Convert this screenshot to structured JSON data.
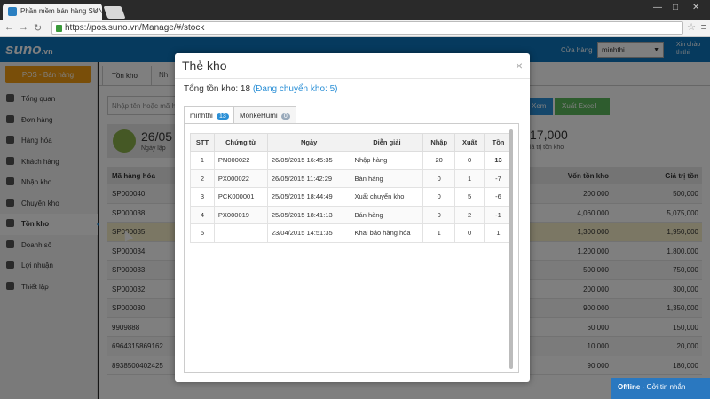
{
  "browser": {
    "tab_title": "Phần mềm bán hàng SUNO",
    "url": "https://pos.suno.vn/Manage/#/stock"
  },
  "header": {
    "logo_main": "suno",
    "logo_suffix": ".vn",
    "store_label": "Cửa hàng",
    "store_value": "minhthi",
    "greeting_line1": "Xin chào",
    "greeting_line2": "thithi"
  },
  "sidebar": {
    "pos_button": "POS - Bán hàng",
    "items": [
      {
        "label": "Tổng quan"
      },
      {
        "label": "Đơn hàng"
      },
      {
        "label": "Hàng hóa"
      },
      {
        "label": "Khách hàng"
      },
      {
        "label": "Nhập kho"
      },
      {
        "label": "Chuyển kho"
      },
      {
        "label": "Tồn kho"
      },
      {
        "label": "Doanh số"
      },
      {
        "label": "Lợi nhuận"
      },
      {
        "label": "Thiết lập"
      }
    ]
  },
  "main": {
    "tab_active": "Tồn kho",
    "tab_second": "Nh",
    "search_placeholder": "Nhập tên hoặc mã h",
    "btn_view": "Xem",
    "btn_excel": "Xuất Excel",
    "summary_left_value": "26/05",
    "summary_left_label": "Ngày lập",
    "summary_right_value": "17,000",
    "summary_right_label": "iá trị tồn kho",
    "grid_headers": [
      "Mã hàng hóa",
      "Vốn tồn kho",
      "Giá trị tồn"
    ],
    "grid_rows": [
      [
        "SP000040",
        "200,000",
        "500,000"
      ],
      [
        "SP000038",
        "4,060,000",
        "5,075,000"
      ],
      [
        "SP000035",
        "1,300,000",
        "1,950,000"
      ],
      [
        "SP000034",
        "1,200,000",
        "1,800,000"
      ],
      [
        "SP000033",
        "500,000",
        "750,000"
      ],
      [
        "SP000032",
        "200,000",
        "300,000"
      ],
      [
        "SP000030",
        "900,000",
        "1,350,000"
      ],
      [
        "9909888",
        "60,000",
        "150,000"
      ],
      [
        "6964315869162",
        "10,000",
        "20,000"
      ],
      [
        "8938500402425",
        "90,000",
        "180,000"
      ]
    ]
  },
  "modal": {
    "title": "Thẻ kho",
    "close": "×",
    "stock_prefix": "Tổng tồn kho: 18",
    "stock_transfer": "(Đang chuyển kho: 5)",
    "tabs": [
      {
        "label": "minhthi",
        "badge": "13"
      },
      {
        "label": "MonkeHumi",
        "badge": "0"
      }
    ],
    "table_headers": [
      "STT",
      "Chứng từ",
      "Ngày",
      "Diễn giải",
      "Nhập",
      "Xuất",
      "Tồn"
    ],
    "rows": [
      [
        "1",
        "PN000022",
        "26/05/2015 16:45:35",
        "Nhập hàng",
        "20",
        "0",
        "13"
      ],
      [
        "2",
        "PX000022",
        "26/05/2015 11:42:29",
        "Bán hàng",
        "0",
        "1",
        "-7"
      ],
      [
        "3",
        "PCK000001",
        "25/05/2015 18:44:49",
        "Xuất chuyển kho",
        "0",
        "5",
        "-6"
      ],
      [
        "4",
        "PX000019",
        "25/05/2015 18:41:13",
        "Bán hàng",
        "0",
        "2",
        "-1"
      ],
      [
        "5",
        "",
        "23/04/2015 14:51:35",
        "Khai báo hàng hóa",
        "1",
        "0",
        "1"
      ]
    ]
  },
  "chat": {
    "status": "Offline",
    "text": "Gởi tin nhắn"
  }
}
